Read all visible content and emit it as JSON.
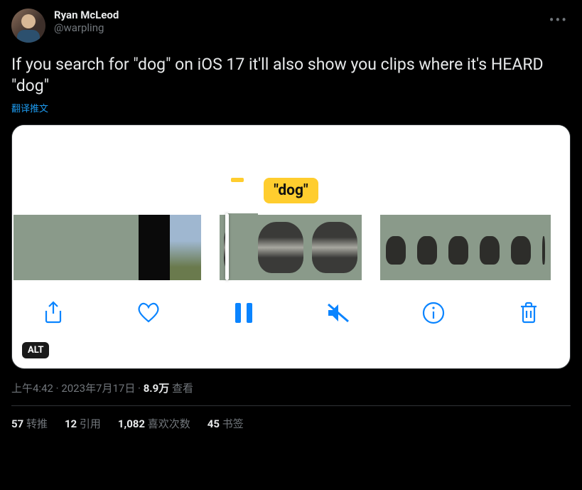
{
  "user": {
    "display_name": "Ryan McLeod",
    "handle": "@warpling"
  },
  "tweet_text": "If you search for \"dog\" on iOS 17 it'll also show you clips where it's HEARD \"dog\"",
  "translate_label": "翻译推文",
  "media": {
    "search_badge": "\"dog\"",
    "alt_badge": "ALT",
    "toolbar_icons": {
      "share": "share-icon",
      "like": "heart-icon",
      "pause": "pause-icon",
      "mute": "mute-icon",
      "info": "info-icon",
      "trash": "trash-icon"
    }
  },
  "meta": {
    "time": "上午4:42",
    "dot": " · ",
    "date": "2023年7月17日",
    "views_count": "8.9万",
    "views_label": " 查看"
  },
  "stats": {
    "retweets_count": "57",
    "retweets_label": " 转推",
    "quotes_count": "12",
    "quotes_label": " 引用",
    "likes_count": "1,082",
    "likes_label": " 喜欢次数",
    "bookmarks_count": "45",
    "bookmarks_label": " 书签"
  }
}
